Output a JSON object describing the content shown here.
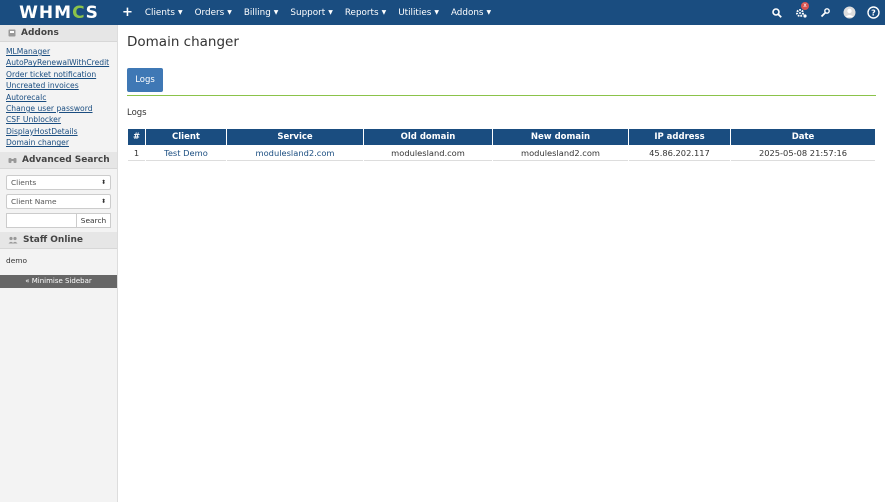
{
  "brand": {
    "logo_prefix": "WHM",
    "logo_gear": "C",
    "logo_suffix": "S"
  },
  "nav": {
    "plus": "+",
    "items": [
      "Clients",
      "Orders",
      "Billing",
      "Support",
      "Reports",
      "Utilities",
      "Addons"
    ],
    "right_icons": [
      "search-icon",
      "gear-alert-icon",
      "wrench-icon",
      "user-avatar-icon",
      "help-icon"
    ],
    "badge": "x"
  },
  "sidebar": {
    "addons_title": "Addons",
    "addon_links": [
      "MLManager",
      "AutoPayRenewalWithCredit",
      "Order ticket notification",
      "Uncreated invoices",
      "Autorecalc",
      "Change user password",
      "CSF Unblocker",
      "DisplayHostDetails",
      "Domain changer"
    ],
    "advanced_search_title": "Advanced Search",
    "search_type": "Clients",
    "search_field": "Client Name",
    "search_button": "Search",
    "staff_online_title": "Staff Online",
    "staff": "demo",
    "minimise": "« Minimise Sidebar"
  },
  "main": {
    "title": "Domain changer",
    "tab_logs": "Logs",
    "section_label": "Logs",
    "table": {
      "headers": [
        "#",
        "Client",
        "Service",
        "Old domain",
        "New domain",
        "IP address",
        "Date"
      ],
      "rows": [
        [
          "1",
          "Test Demo",
          "modulesland2.com",
          "modulesland.com",
          "modulesland2.com",
          "45.86.202.117",
          "2025-05-08 21:57:16"
        ]
      ]
    }
  },
  "colors": {
    "nav_bg": "#1a4d80",
    "accent_green": "#8bc34a",
    "tab_active": "#3f78b5",
    "badge": "#d9534f"
  }
}
